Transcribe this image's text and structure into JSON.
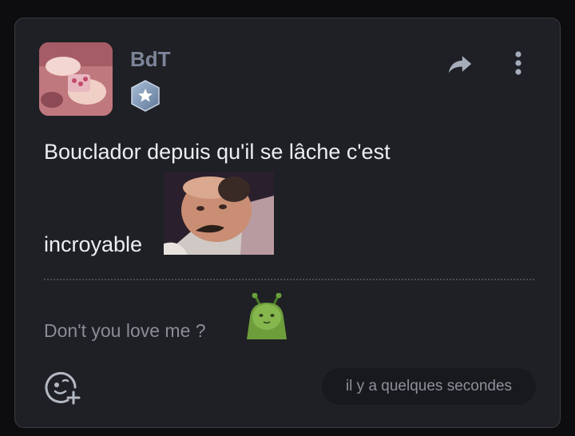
{
  "post": {
    "author": "BdT",
    "message_line1": "Bouclador depuis qu'il se lâche c'est",
    "message_line2": "incroyable",
    "signature": "Don't you love me ?",
    "timestamp": "il y a quelques secondes"
  },
  "icons": {
    "share": "share-forward-icon",
    "more": "vertical-ellipsis-icon",
    "badge": "star-hexagon-badge-icon",
    "react": "add-reaction-icon"
  },
  "colors": {
    "card_bg": "#1f2025",
    "username": "#7c8598",
    "message_text": "#eceef2",
    "muted_text": "#8a8d95",
    "timestamp_bg": "#18191d"
  }
}
